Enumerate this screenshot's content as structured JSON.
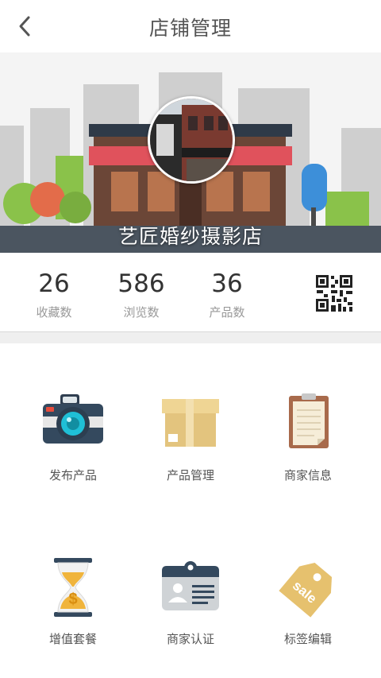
{
  "header": {
    "title": "店铺管理"
  },
  "shop": {
    "name": "艺匠婚纱摄影店"
  },
  "stats": [
    {
      "value": "26",
      "label": "收藏数"
    },
    {
      "value": "586",
      "label": "浏览数"
    },
    {
      "value": "36",
      "label": "产品数"
    }
  ],
  "menu": [
    {
      "label": "发布产品",
      "icon": "camera-icon"
    },
    {
      "label": "产品管理",
      "icon": "box-icon"
    },
    {
      "label": "商家信息",
      "icon": "clipboard-icon"
    },
    {
      "label": "增值套餐",
      "icon": "hourglass-icon"
    },
    {
      "label": "商家认证",
      "icon": "id-badge-icon"
    },
    {
      "label": "标签编辑",
      "icon": "sale-tag-icon"
    }
  ],
  "sale_tag_text": "sale",
  "colors": {
    "camera": "#34495e",
    "lens": "#1fbfd6",
    "box": "#e3c47e",
    "clipboard": "#a86a4b",
    "hourglass": "#f0b43c",
    "tag": "#e6c16e"
  }
}
